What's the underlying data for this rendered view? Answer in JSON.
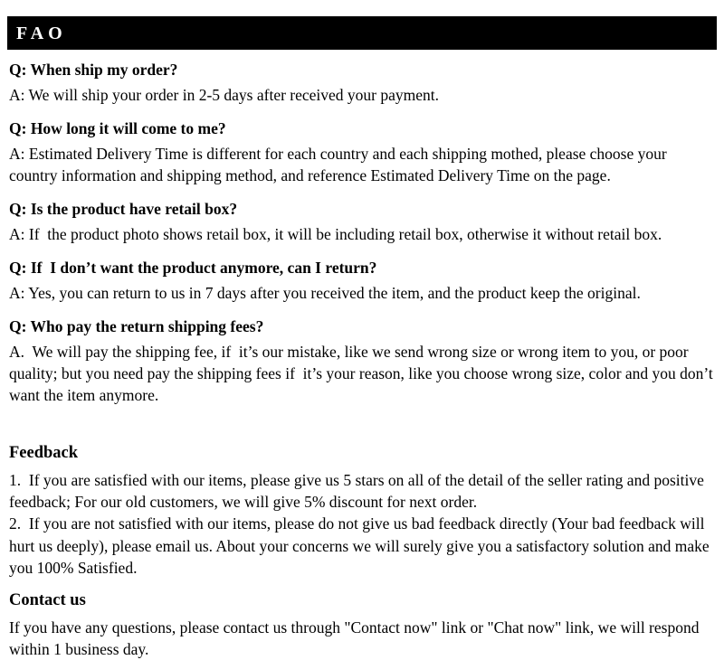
{
  "header": {
    "title": "FAO"
  },
  "faq": {
    "items": [
      {
        "question": "Q: When ship my order?",
        "answer": "A: We will ship your order in 2-5 days after received your payment."
      },
      {
        "question": "Q: How long it will come to me?",
        "answer": "A: Estimated Delivery Time is different for each country and each shipping mothed, please choose your country information and shipping method, and reference Estimated Delivery Time on the page."
      },
      {
        "question": "Q: Is the product have retail box?",
        "answer": "A: If  the product photo shows retail box, it will be including retail box, otherwise it without retail box."
      },
      {
        "question": "Q: If  I don’t want the product anymore, can I return?",
        "answer": "A: Yes, you can return to us in 7 days after you received the item, and the product keep the original."
      },
      {
        "question": "Q: Who pay the return shipping fees?",
        "answer": "A.  We will pay the shipping fee, if  it’s our mistake, like we send wrong size or wrong item to you, or poor quality; but you need pay the shipping fees if  it’s your reason, like you choose wrong size, color and you don’t want the item anymore."
      }
    ]
  },
  "feedback": {
    "heading": "Feedback",
    "item_1": "1.  If you are satisfied with our items, please give us 5 stars on all of the detail of the seller rating and positive feedback; For our old customers, we will give 5% discount for next order.",
    "item_2": "2.  If you are not satisfied with our items, please do not give us bad feedback directly (Your bad feedback will hurt us deeply), please email us. About your concerns we will surely give you a satisfactory solution and make you 100% Satisfied."
  },
  "contact": {
    "heading": "Contact us",
    "body": "If you have any questions, please contact us through \"Contact now\" link or \"Chat now\" link, we will respond within 1 business day."
  },
  "colors": {
    "header_background": "#000000",
    "header_text": "#ffffff",
    "page_background": "#ffffff",
    "body_text": "#000000"
  }
}
